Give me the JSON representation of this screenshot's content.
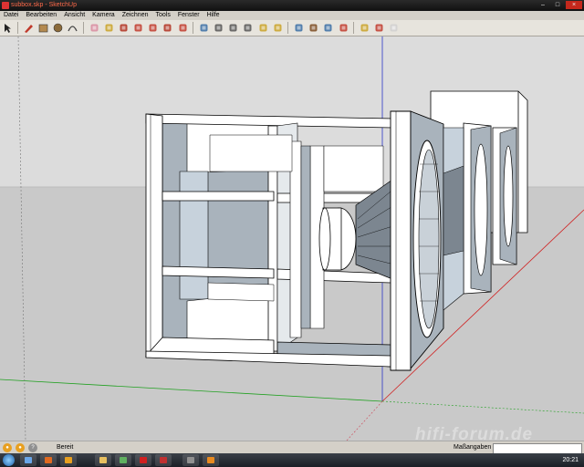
{
  "window": {
    "title": "subbox.skp - SketchUp",
    "minimize_glyph": "–",
    "maximize_glyph": "□",
    "close_glyph": "×"
  },
  "menubar": {
    "items": [
      "Datei",
      "Bearbeiten",
      "Ansicht",
      "Kamera",
      "Zeichnen",
      "Tools",
      "Fenster",
      "Hilfe"
    ]
  },
  "toolbar": {
    "tools": [
      {
        "name": "select-icon",
        "color": "#222222"
      },
      {
        "name": "pencil-icon",
        "color": "#c0392b"
      },
      {
        "name": "rectangle-icon",
        "color": "#b48a50"
      },
      {
        "name": "circle-icon",
        "color": "#8c6b3a"
      },
      {
        "name": "arc-icon",
        "color": "#444444"
      },
      {
        "name": "eraser-icon",
        "color": "#d88ca0"
      },
      {
        "name": "paint-bucket-icon",
        "color": "#c9a227"
      },
      {
        "name": "push-pull-icon",
        "color": "#b03020"
      },
      {
        "name": "move-icon",
        "color": "#c0392b"
      },
      {
        "name": "rotate-icon",
        "color": "#c0392b"
      },
      {
        "name": "follow-me-icon",
        "color": "#b03020"
      },
      {
        "name": "offset-icon",
        "color": "#c0392b"
      },
      {
        "name": "orbit-icon",
        "color": "#3a6ea5"
      },
      {
        "name": "pan-icon",
        "color": "#555555"
      },
      {
        "name": "zoom-icon",
        "color": "#555555"
      },
      {
        "name": "zoom-extents-icon",
        "color": "#555555"
      },
      {
        "name": "tape-measure-icon",
        "color": "#c9a227"
      },
      {
        "name": "text-icon",
        "color": "#c9a227"
      },
      {
        "name": "axes-icon",
        "color": "#3a6ea5"
      },
      {
        "name": "walk-icon",
        "color": "#7a4a20"
      },
      {
        "name": "look-around-icon",
        "color": "#3a6ea5"
      },
      {
        "name": "position-camera-icon",
        "color": "#c0392b"
      },
      {
        "name": "components-icon",
        "color": "#c9a227"
      },
      {
        "name": "materials-icon",
        "color": "#c0392b"
      },
      {
        "name": "warehouse-icon",
        "color": "#d0d0d0"
      }
    ]
  },
  "statusbar": {
    "text": "Bereit",
    "measure_label": "Maßangaben",
    "measure_value": ""
  },
  "taskbar": {
    "clock": "20:21"
  },
  "watermark": "hifi-forum.de",
  "colors": {
    "sky": "#d9d9d9",
    "ground": "#c8c8c8",
    "panel_face": "#ffffff",
    "panel_shade": "#a9b3bc",
    "panel_dark": "#7c8690",
    "axis_blue": "#2a35c8",
    "axis_red": "#d02020",
    "axis_green": "#20a020",
    "window_close": "#c4281c"
  }
}
